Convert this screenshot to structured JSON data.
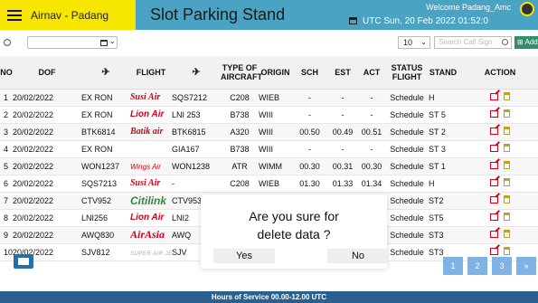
{
  "header": {
    "brand": "Airnav - Padang",
    "title": "Slot Parking Stand",
    "welcome": "Welcome Padang_Amc",
    "utc": "UTC Sun, 20 Feb 2022 01:52:0"
  },
  "toolbar": {
    "page_size": "10",
    "search_placeholder": "Search Call Sign",
    "add_label": "Add"
  },
  "table": {
    "headers": [
      "NO",
      "DOF",
      "plane-departure-icon",
      "FLIGHT",
      "plane-arrival-icon",
      "TYPE OF AIRCRAFT",
      "ORIGIN",
      "SCH",
      "EST",
      "ACT",
      "STATUS FLIGHT",
      "STAND",
      "ACTION"
    ],
    "rows": [
      {
        "no": "1",
        "dof": "20/02/2022",
        "callsign": "EX RON",
        "logo": "Sriwijaya Air",
        "flight": "SQS7212",
        "type": "C208",
        "origin": "WIEB",
        "sch": "-",
        "est": "-",
        "act": "-",
        "status": "Schedule",
        "stand": "H"
      },
      {
        "no": "2",
        "dof": "20/02/2022",
        "callsign": "EX RON",
        "logo": "Lion Air",
        "flight": "LNI 253",
        "type": "B738",
        "origin": "WIII",
        "sch": "-",
        "est": "-",
        "act": "-",
        "status": "Schedule",
        "stand": "ST 5"
      },
      {
        "no": "3",
        "dof": "20/02/2022",
        "callsign": "BTK6814",
        "logo": "Batik Air",
        "flight": "BTK6815",
        "type": "A320",
        "origin": "WIII",
        "sch": "00.50",
        "est": "00.49",
        "act": "00.51",
        "status": "Schedule",
        "stand": "ST 2"
      },
      {
        "no": "4",
        "dof": "20/02/2022",
        "callsign": "EX RON",
        "logo": "Garuda",
        "flight": "GIA167",
        "type": "B738",
        "origin": "WIII",
        "sch": "-",
        "est": "-",
        "act": "-",
        "status": "Schedule",
        "stand": "ST 3"
      },
      {
        "no": "5",
        "dof": "20/02/2022",
        "callsign": "WON1237",
        "logo": "Wings Air",
        "flight": "WON1238",
        "type": "ATR",
        "origin": "WIMM",
        "sch": "00.30",
        "est": "00.31",
        "act": "00.30",
        "status": "Schedule",
        "stand": "ST 1"
      },
      {
        "no": "6",
        "dof": "20/02/2022",
        "callsign": "SQS7213",
        "logo": "Susi Air",
        "flight": "-",
        "type": "C208",
        "origin": "WIEB",
        "sch": "01.30",
        "est": "01.33",
        "act": "01.34",
        "status": "Schedule",
        "stand": "H"
      },
      {
        "no": "7",
        "dof": "20/02/2022",
        "callsign": "CTV952",
        "logo": "Citilink",
        "flight": "CTV953",
        "type": "A320",
        "origin": "WIII",
        "sch": "01.35",
        "est": "01.35",
        "act": "01.40",
        "status": "Schedule",
        "stand": "ST2"
      },
      {
        "no": "8",
        "dof": "20/02/2022",
        "callsign": "LNI256",
        "logo": "Lion Air",
        "flight": "LNI2",
        "type": "",
        "origin": "",
        "sch": "",
        "est": "",
        "act": "",
        "status": "Schedule",
        "stand": "ST5"
      },
      {
        "no": "9",
        "dof": "20/02/2022",
        "callsign": "AWQ830",
        "logo": "AirAsia",
        "flight": "AWQ",
        "type": "",
        "origin": "",
        "sch": "",
        "est": "",
        "act": "",
        "status": "Schedule",
        "stand": "ST3"
      },
      {
        "no": "10",
        "dof": "20/02/2022",
        "callsign": "SJV812",
        "logo": "Super Air Jet",
        "flight": "SJV",
        "type": "",
        "origin": "",
        "sch": "",
        "est": "",
        "act": "",
        "status": "Schedule",
        "stand": "ST3"
      }
    ]
  },
  "pagination": [
    "1",
    "2",
    "3",
    "»"
  ],
  "footer": "Hours of Service 00.00-12.00 UTC",
  "modal": {
    "line1": "Are you sure for",
    "line2": "delete data ?",
    "yes": "Yes",
    "no": "No"
  },
  "colors": {
    "header_bg": "#4aa3c2",
    "brand_bg": "#f6e600",
    "footer_bg": "#2a6090",
    "pager_bg": "#7fb3e6"
  }
}
